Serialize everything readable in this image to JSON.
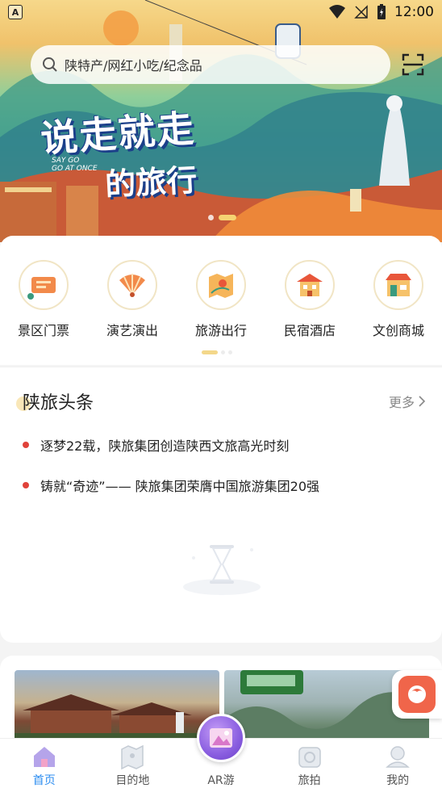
{
  "status_bar": {
    "left_icon_label": "A",
    "time": "12:00"
  },
  "search": {
    "placeholder": "陕特产/网红小吃/纪念品"
  },
  "banner": {
    "headline_line1": "说走就走",
    "headline_line2": "的旅行",
    "subline1": "SAY GO",
    "subline2": "GO AT ONCE",
    "slide_count": 2,
    "active_slide": 1
  },
  "categories": {
    "items": [
      {
        "label": "景区门票",
        "icon": "ticket-icon"
      },
      {
        "label": "演艺演出",
        "icon": "fan-icon"
      },
      {
        "label": "旅游出行",
        "icon": "map-icon"
      },
      {
        "label": "民宿酒店",
        "icon": "hotel-icon"
      },
      {
        "label": "文创商城",
        "icon": "shop-icon"
      }
    ],
    "page_count": 3,
    "active_page": 0
  },
  "news": {
    "title": "陕旅头条",
    "more_label": "更多",
    "items": [
      {
        "text": "逐梦22载，陕旅集团创造陕西文旅高光时刻"
      },
      {
        "text": "铸就“奇迹”—— 陕旅集团荣膺中国旅游集团20强"
      }
    ]
  },
  "tabs": [
    {
      "label": "首页",
      "icon": "home-icon",
      "active": true
    },
    {
      "label": "目的地",
      "icon": "destination-icon",
      "active": false
    },
    {
      "label": "AR游",
      "icon": "ar-icon",
      "active": false
    },
    {
      "label": "旅拍",
      "icon": "camera-icon",
      "active": false
    },
    {
      "label": "我的",
      "icon": "profile-icon",
      "active": false
    }
  ],
  "colors": {
    "accent": "#2d8df0",
    "bullet": "#e0423a",
    "banner_title_outline": "#1b3f8a",
    "ar_button": "#8a5ee0",
    "float_button": "#f0654a"
  }
}
